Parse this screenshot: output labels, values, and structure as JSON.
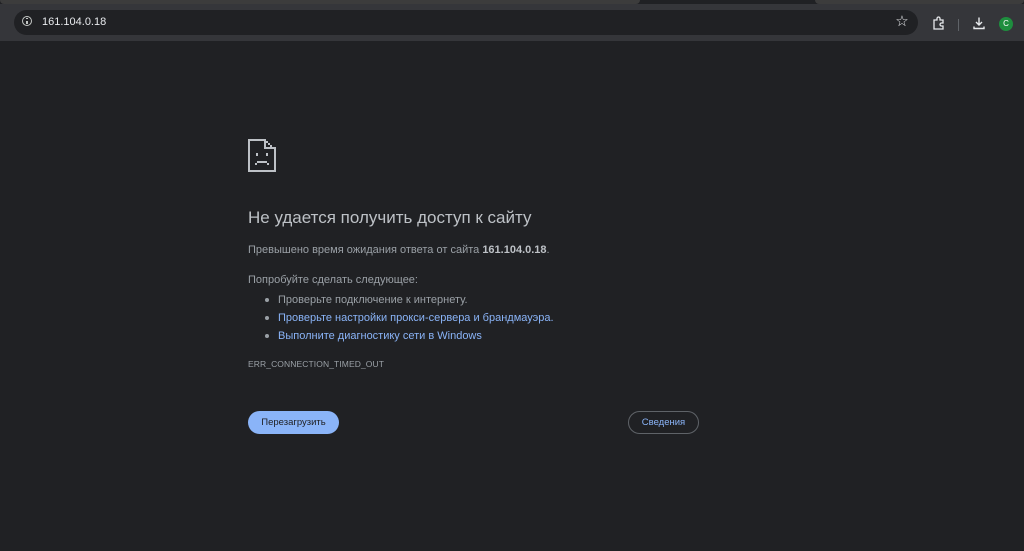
{
  "browser": {
    "url": "161.104.0.18",
    "avatar_letter": "C",
    "icons": [
      "info-icon",
      "star-icon",
      "extensions-icon",
      "download-icon",
      "avatar"
    ]
  },
  "error_page": {
    "icon": "sad-file-icon",
    "title": "Не удается получить доступ к сайту",
    "message_prefix": "Превышено время ожидания ответа от сайта ",
    "message_host": "161.104.0.18",
    "message_suffix": ".",
    "try_label": "Попробуйте сделать следующее:",
    "suggestions": [
      "Проверьте подключение к интернету.",
      "Проверьте настройки прокси-сервера и брандмауэра.",
      "Выполните диагностику сети в Windows"
    ],
    "error_code": "ERR_CONNECTION_TIMED_OUT",
    "reload_label": "Перезагрузить",
    "details_label": "Сведения"
  },
  "colors": {
    "page_bg": "#202124",
    "toolbar_bg": "#35363a",
    "title_text": "#bdc1c6",
    "body_text": "#9aa0a6",
    "link": "#8ab4f8",
    "avatar_bg": "#1e8e3e"
  }
}
